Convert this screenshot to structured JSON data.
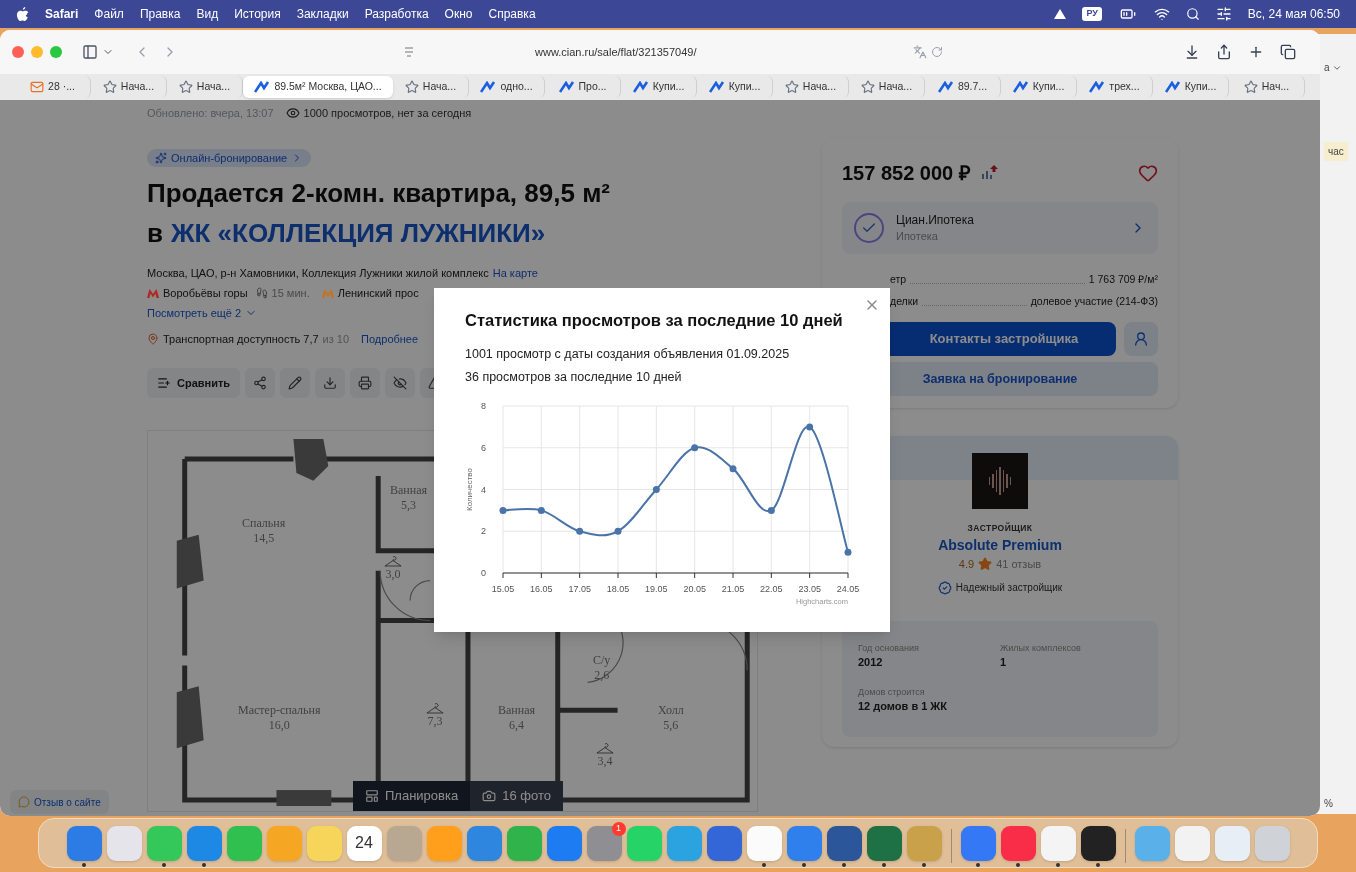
{
  "menu_bar": {
    "app": "Safari",
    "items": [
      "Файл",
      "Правка",
      "Вид",
      "История",
      "Закладки",
      "Разработка",
      "Окно",
      "Справка"
    ],
    "input_source": "РУ",
    "clock": "Вс, 24 мая 06:50"
  },
  "browser": {
    "url": "www.cian.ru/sale/flat/321357049/",
    "tabs": [
      {
        "label": "28 ·...",
        "kind": "mail",
        "selected": false
      },
      {
        "label": "Нача...",
        "kind": "bookmark",
        "selected": false
      },
      {
        "label": "Нача...",
        "kind": "bookmark",
        "selected": false
      },
      {
        "label": "89.5м² Москва, ЦАО...",
        "kind": "site",
        "selected": true
      },
      {
        "label": "Нача...",
        "kind": "bookmark",
        "selected": false
      },
      {
        "label": "одно...",
        "kind": "site",
        "selected": false
      },
      {
        "label": "Про...",
        "kind": "site",
        "selected": false
      },
      {
        "label": "Купи...",
        "kind": "site",
        "selected": false
      },
      {
        "label": "Купи...",
        "kind": "site",
        "selected": false
      },
      {
        "label": "Нача...",
        "kind": "bookmark",
        "selected": false
      },
      {
        "label": "Нача...",
        "kind": "bookmark",
        "selected": false
      },
      {
        "label": "89.7...",
        "kind": "site",
        "selected": false
      },
      {
        "label": "Купи...",
        "kind": "site",
        "selected": false
      },
      {
        "label": "трех...",
        "kind": "site",
        "selected": false
      },
      {
        "label": "Купи...",
        "kind": "site",
        "selected": false
      },
      {
        "label": "Нач...",
        "kind": "bookmark",
        "selected": false
      }
    ]
  },
  "listing": {
    "updated": "Обновлено: вчера, 13:07",
    "views": "1000 просмотров, нет за сегодня",
    "badge": "Онлайн-бронирование",
    "title_line1": "Продается 2-комн. квартира, 89,5 м²",
    "title_prefix": "в",
    "complex_name": "ЖК «КОЛЛЕКЦИЯ ЛУЖНИКИ»",
    "address": "Москва, ЦАО, р-н Хамовники, Коллекция Лужники жилой комплекс",
    "map_link": "На карте",
    "metro": [
      {
        "station": "Воробьёвы горы",
        "color": "#b3261e",
        "walk": "15 мин."
      },
      {
        "station": "Ленинский прос",
        "color": "#c8711c"
      }
    ],
    "more_link": "Посмотреть ещё 2",
    "transport": {
      "label": "Транспортная доступность 7,7",
      "scale": "из 10",
      "link": "Подробнее"
    },
    "compare_button": "Сравнить",
    "rooms": [
      {
        "kind": "room",
        "name": "Ванная",
        "area": "5,3"
      },
      {
        "kind": "room",
        "name": "Спальня",
        "area": "14,5"
      },
      {
        "kind": "wardrobe",
        "area": "3,0"
      },
      {
        "kind": "room",
        "name": "С/у",
        "area": "2,6"
      },
      {
        "kind": "room",
        "name": "Мастер-спальня",
        "area": "16,0"
      },
      {
        "kind": "wardrobe",
        "area": "7,3"
      },
      {
        "kind": "room",
        "name": "Ванная",
        "area": "6,4"
      },
      {
        "kind": "room",
        "name": "Холл",
        "area": "5,6"
      },
      {
        "kind": "wardrobe",
        "area": "3,4"
      }
    ],
    "media_tabs": [
      {
        "label": "Планировка",
        "kind": "plan",
        "selected": true
      },
      {
        "label": "16 фото",
        "kind": "camera",
        "selected": false
      }
    ]
  },
  "feedback_button": "Отзыв о сайте",
  "offer": {
    "price": "157 852 000 ₽",
    "favorite": false,
    "mortgage": {
      "title": "Циан.Ипотека",
      "subtitle": "Ипотека"
    },
    "facts": [
      {
        "label": "етр",
        "value": "1 763 709 ₽/м²"
      },
      {
        "label": "делки",
        "value": "долевое участие (214-ФЗ)"
      }
    ],
    "contact_button": "Контакты застройщика",
    "booking_button": "Заявка на бронирование"
  },
  "developer": {
    "caption": "ЗАСТРОЙЩИК",
    "name": "Absolute Premium",
    "rating": "4.9",
    "reviews": "41 отзыв",
    "badge": "Надежный застройщик",
    "stats": [
      {
        "label": "Год основания",
        "value": "2012"
      },
      {
        "label": "Жилых комплексов",
        "value": "1"
      },
      {
        "label": "Домов строится",
        "value": "12 домов в 1 ЖК"
      }
    ]
  },
  "modal": {
    "title": "Статистика просмотров за последние 10 дней",
    "lines": [
      "1001 просмотр с даты создания объявления 01.09.2025",
      "36 просмотров за последние 10 дней"
    ],
    "credit": "Highcharts.com",
    "chart_data": {
      "type": "line",
      "ylabel": "Количество",
      "categories": [
        "15.05",
        "16.05",
        "17.05",
        "18.05",
        "19.05",
        "20.05",
        "21.05",
        "22.05",
        "23.05",
        "24.05"
      ],
      "series": [
        {
          "color": "#4a74a8",
          "marker": true,
          "values": [
            3,
            3,
            2,
            2,
            4,
            6,
            5,
            3,
            7,
            1
          ]
        }
      ],
      "grid": true,
      "ylim": [
        0,
        8
      ],
      "yticks": [
        0,
        2,
        4,
        6,
        8
      ]
    }
  },
  "background_window": {
    "texts": [
      "а",
      "час",
      "%"
    ]
  },
  "dock": {
    "items": [
      {
        "kind": "app",
        "color": "#2d7be5",
        "running": true
      },
      {
        "kind": "app",
        "color": "#e4e4ea",
        "running": false
      },
      {
        "kind": "app",
        "color": "#34c759",
        "running": true
      },
      {
        "kind": "app",
        "color": "#1e88e5",
        "running": true
      },
      {
        "kind": "app",
        "color": "#30c04f",
        "running": false
      },
      {
        "kind": "app",
        "color": "#f5a623",
        "running": false
      },
      {
        "kind": "app",
        "color": "#f7d55b",
        "running": false
      },
      {
        "kind": "app",
        "color": "#ffffff",
        "running": false,
        "label": "24"
      },
      {
        "kind": "app",
        "color": "#b9a891",
        "running": false
      },
      {
        "kind": "app",
        "color": "#ff9f1c",
        "running": false
      },
      {
        "kind": "app",
        "color": "#2e86de",
        "running": false
      },
      {
        "kind": "app",
        "color": "#2fb34a",
        "running": false
      },
      {
        "kind": "app",
        "color": "#1d7cf2",
        "running": false
      },
      {
        "kind": "app",
        "color": "#8e8e93",
        "running": false,
        "badge": "1"
      },
      {
        "kind": "app",
        "color": "#25d366",
        "running": false
      },
      {
        "kind": "app",
        "color": "#2aa3e0",
        "running": false
      },
      {
        "kind": "app",
        "color": "#3366d6",
        "running": false
      },
      {
        "kind": "app",
        "color": "#fbfbfb",
        "running": true
      },
      {
        "kind": "app",
        "color": "#2f80ed",
        "running": true
      },
      {
        "kind": "app",
        "color": "#2b579a",
        "running": true
      },
      {
        "kind": "app",
        "color": "#1e7145",
        "running": true
      },
      {
        "kind": "app",
        "color": "#c9a14a",
        "running": true
      },
      {
        "kind": "separator"
      },
      {
        "kind": "app",
        "color": "#3478f6",
        "running": true
      },
      {
        "kind": "app",
        "color": "#fa2d48",
        "running": true
      },
      {
        "kind": "app",
        "color": "#f4f4f4",
        "running": true
      },
      {
        "kind": "app",
        "color": "#222222",
        "running": true
      },
      {
        "kind": "separator"
      },
      {
        "kind": "app",
        "color": "#5ab0e8",
        "running": false
      },
      {
        "kind": "app",
        "color": "#f2f2f2",
        "running": false
      },
      {
        "kind": "app",
        "color": "#e8eef5",
        "running": false
      },
      {
        "kind": "app",
        "color": "#cfd3d8",
        "running": false
      }
    ]
  }
}
